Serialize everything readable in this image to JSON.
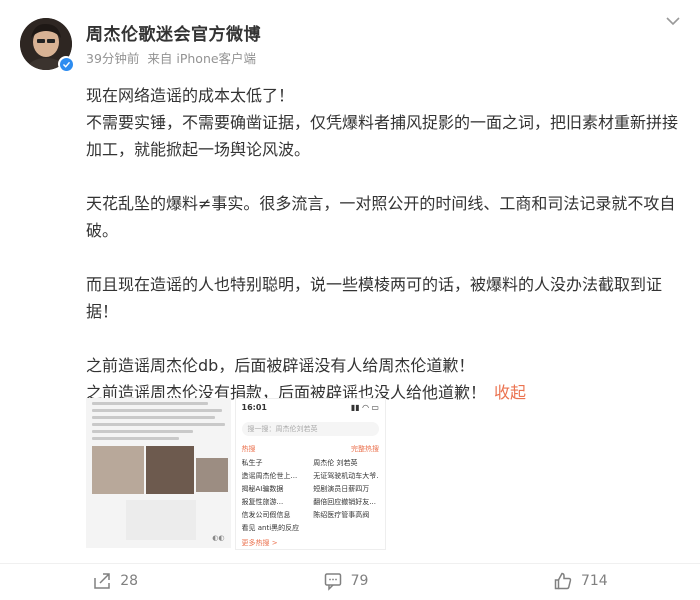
{
  "post": {
    "author": "周杰伦歌迷会官方微博",
    "time": "39分钟前",
    "source": "来自 iPhone客户端",
    "paragraphs": [
      "现在网络造谣的成本太低了！",
      "不需要实锤，不需要确凿证据，仅凭爆料者捕风捉影的一面之词，把旧素材重新拼接加工，就能掀起一场舆论风波。",
      "天花乱坠的爆料≠事实。很多流言，一对照公开的时间线、工商和司法记录就不攻自破。",
      "而且现在造谣的人也特别聪明，说一些模棱两可的话，被爆料的人没办法截取到证据！",
      "之前造谣周杰伦db，后面被辟谣没有人给周杰伦道歉！",
      "之前造谣周杰伦没有捐款，后面被辟谣也没人给他道歉！"
    ],
    "collapse_label": "收起"
  },
  "media": {
    "screenshot_time": "16:01",
    "search_placeholder": "搜一搜：周杰伦刘若英",
    "hot_label": "热搜",
    "hot_more_right": "完整热搜",
    "hot_items": [
      "私生子",
      "周杰伦 刘若英",
      "造谣周杰伦世上...",
      "无证驾驶机动车大爷...",
      "揭秘AI骗数据",
      "短剧演员日薪四万",
      "报复性旅游...",
      "翻倍回应撤销好友...",
      "信发公司假信息",
      "陈绍医疗管事高阀",
      "看见 anti黑的反应",
      ""
    ],
    "more_hot": "更多热搜 >"
  },
  "actions": {
    "share_count": "28",
    "comment_count": "79",
    "like_count": "714"
  },
  "colors": {
    "accent": "#eb7350",
    "verified": "#2d8cf0",
    "meta": "#939393"
  }
}
